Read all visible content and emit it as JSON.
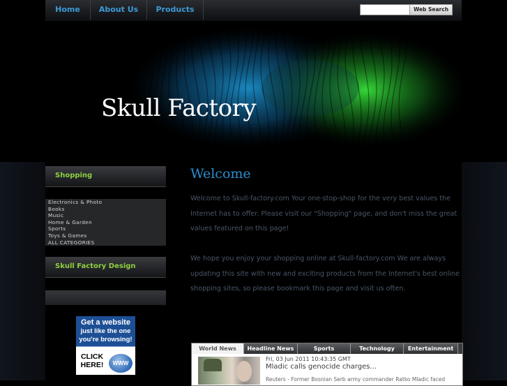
{
  "nav": {
    "items": [
      {
        "label": "Home"
      },
      {
        "label": "About Us"
      },
      {
        "label": "Products"
      }
    ],
    "search_value": "",
    "search_button": "Web Search"
  },
  "header": {
    "title": "Skull Factory"
  },
  "sidebar": {
    "shopping_title": "Shopping",
    "categories": [
      "Electronics & Photo",
      "Books",
      "Music",
      "Home & Garden",
      "Sports",
      "Toys & Games",
      "ALL CATEGORIES"
    ],
    "design_title": "Skull Factory Design",
    "ad": {
      "line1": "Get a website",
      "line2": "just like the one",
      "line3": "you're browsing!",
      "click": "CLICK HERE!",
      "badge": "WWW"
    }
  },
  "main": {
    "title": "Welcome",
    "paragraph1": "Welcome to Skull-factory.com Your one-stop-shop for the very best values the Internet has to offer. Please visit our \"Shopping\" page, and don't miss the great values featured on this page!",
    "paragraph2": "We hope you enjoy your shopping online at Skull-factory.com We are always updating this site with new and exciting products from the Internet's best online shopping sites, so please bookmark this page and visit us often."
  },
  "news": {
    "tabs": [
      "World News",
      "Headline News",
      "Sports",
      "Technology",
      "Entertainment"
    ],
    "active_tab": "World News",
    "date": "Fri, 03 Jun 2011 10:43:35 GMT",
    "headline": "Mladic calls genocide charges...",
    "snippet": "Reuters - Former Bosnian Serb army commander Ratko Mladic faced"
  },
  "colors": {
    "nav_link": "#3d9ad6",
    "sidebar_heading": "#8fd13f",
    "welcome_title": "#2c8ecc",
    "body_text": "#4a5668"
  }
}
